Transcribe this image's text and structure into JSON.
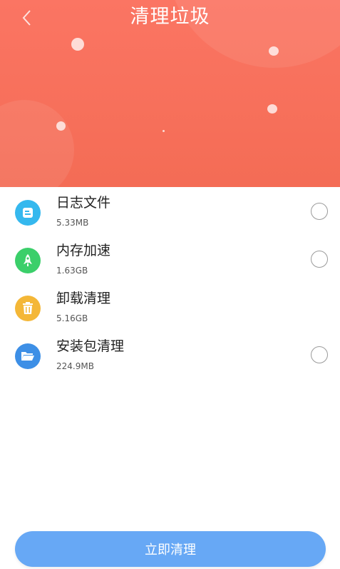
{
  "header": {
    "title": "清理垃圾",
    "back_icon": "chevron-left-icon",
    "background_color": "#f46c55"
  },
  "items": [
    {
      "name": "日志文件",
      "size": "5.33MB",
      "icon": "document-icon",
      "color": "#35b8ee",
      "has_radio": true
    },
    {
      "name": "内存加速",
      "size": "1.63GB",
      "icon": "rocket-icon",
      "color": "#3bcf6a",
      "has_radio": true
    },
    {
      "name": "卸载清理",
      "size": "5.16GB",
      "icon": "trash-icon",
      "color": "#f4b737",
      "has_radio": false
    },
    {
      "name": "安装包清理",
      "size": "224.9MB",
      "icon": "folder-icon",
      "color": "#3d8fe6",
      "has_radio": true
    }
  ],
  "action": {
    "clean_label": "立即清理",
    "button_color": "#67a8f5"
  }
}
